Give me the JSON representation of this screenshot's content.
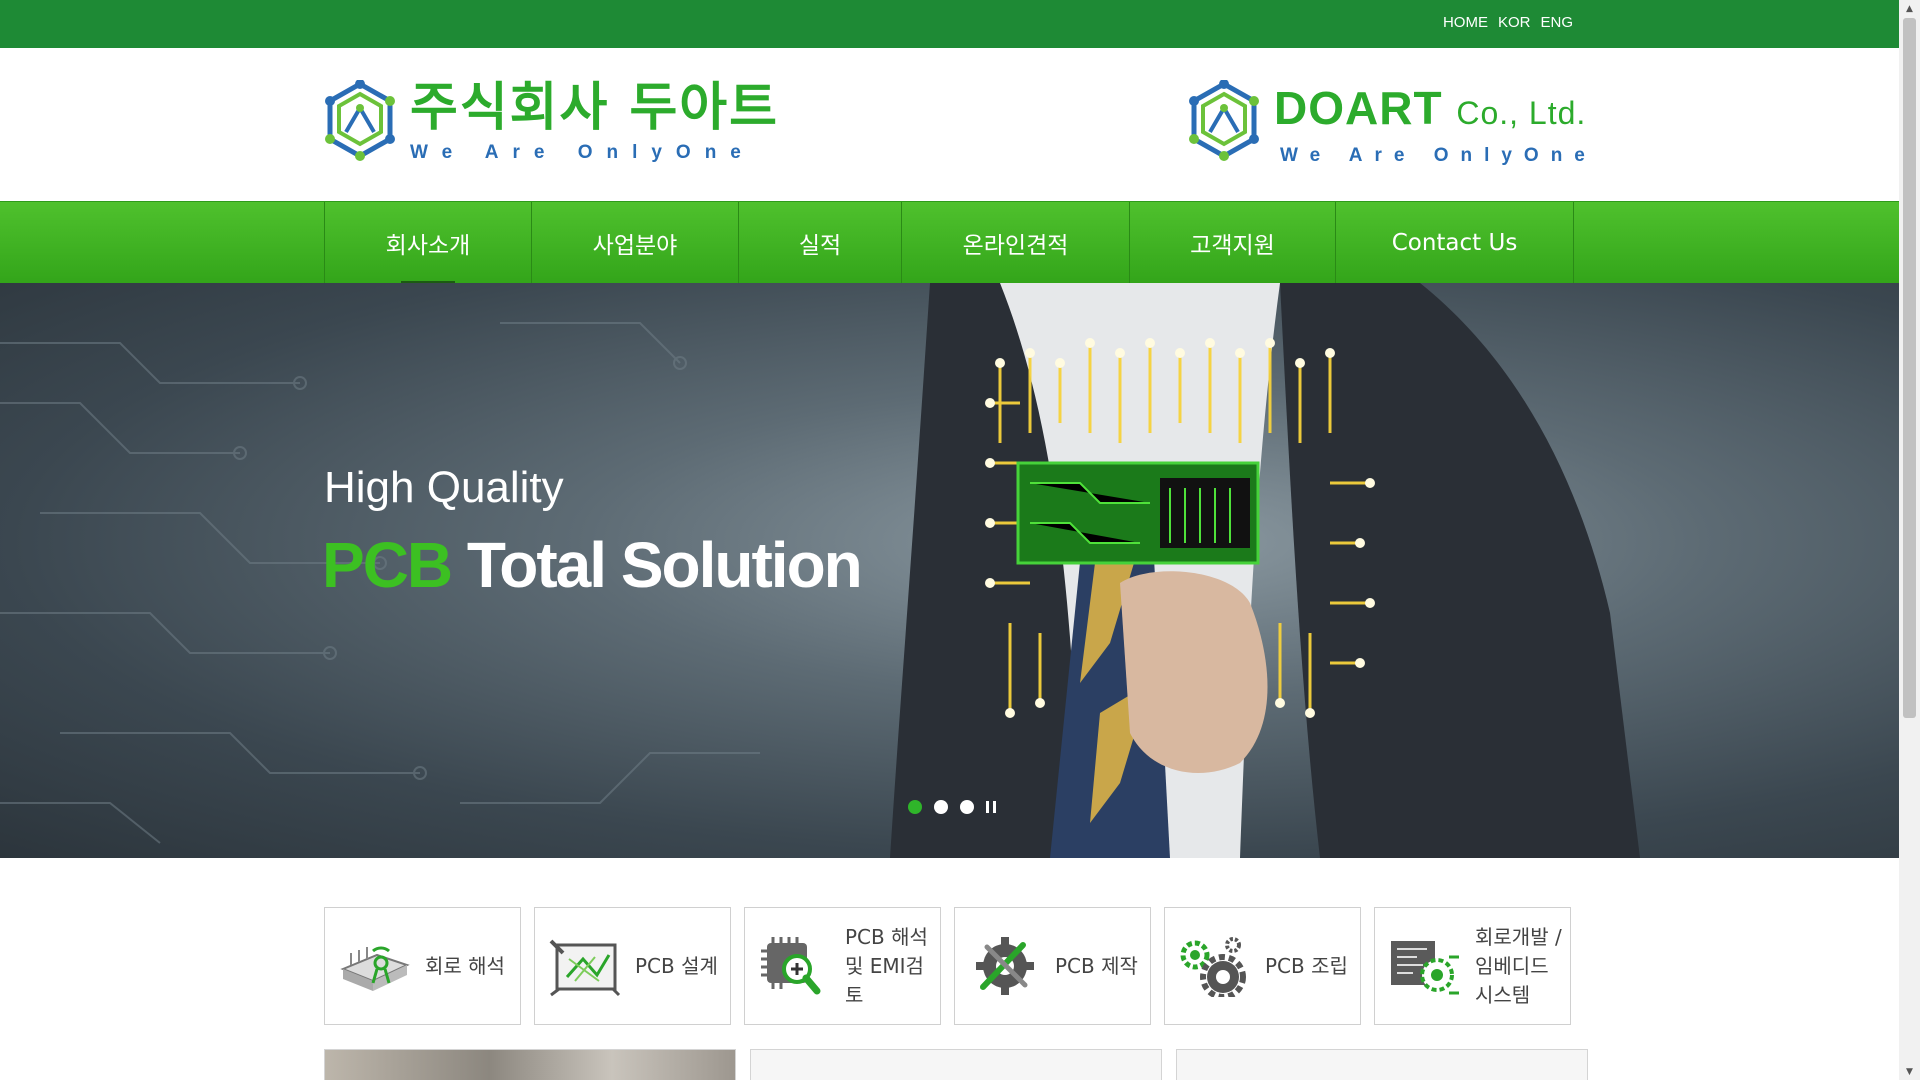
{
  "topbar": {
    "links": [
      "HOME",
      "KOR",
      "ENG"
    ]
  },
  "header": {
    "left_logo": {
      "name": "주식회사 두아트",
      "slogan": "We Are OnlyOne"
    },
    "right_logo": {
      "name": "DOART",
      "suffix": "Co., Ltd.",
      "slogan": "We Are OnlyOne"
    }
  },
  "nav": {
    "items": [
      {
        "label": "회사소개",
        "active": true
      },
      {
        "label": "사업분야",
        "active": false
      },
      {
        "label": "실적",
        "active": false
      },
      {
        "label": "온라인견적",
        "active": false
      },
      {
        "label": "고객지원",
        "active": false
      },
      {
        "label": "Contact Us",
        "active": false
      }
    ]
  },
  "hero": {
    "line1": "High Quality",
    "line2_accent": "PCB",
    "line2_rest": " Total Solution",
    "slide_count": 3,
    "active_slide": 1
  },
  "services": [
    {
      "label": "회로 해석",
      "icon": "circuit-analysis-icon"
    },
    {
      "label": "PCB 설계",
      "icon": "pcb-design-icon"
    },
    {
      "label": "PCB 해석\n및 EMI검토",
      "icon": "pcb-analysis-icon"
    },
    {
      "label": "PCB 제작",
      "icon": "pcb-manufacture-icon"
    },
    {
      "label": "PCB 조립",
      "icon": "gears-icon"
    },
    {
      "label": "회로개발 /\n임베디드\n시스템",
      "icon": "embedded-system-icon"
    }
  ],
  "colors": {
    "topbar": "#1e8a35",
    "brand_green": "#2cab2c",
    "nav_green": "#3db322",
    "slogan_blue": "#2a6db5"
  }
}
